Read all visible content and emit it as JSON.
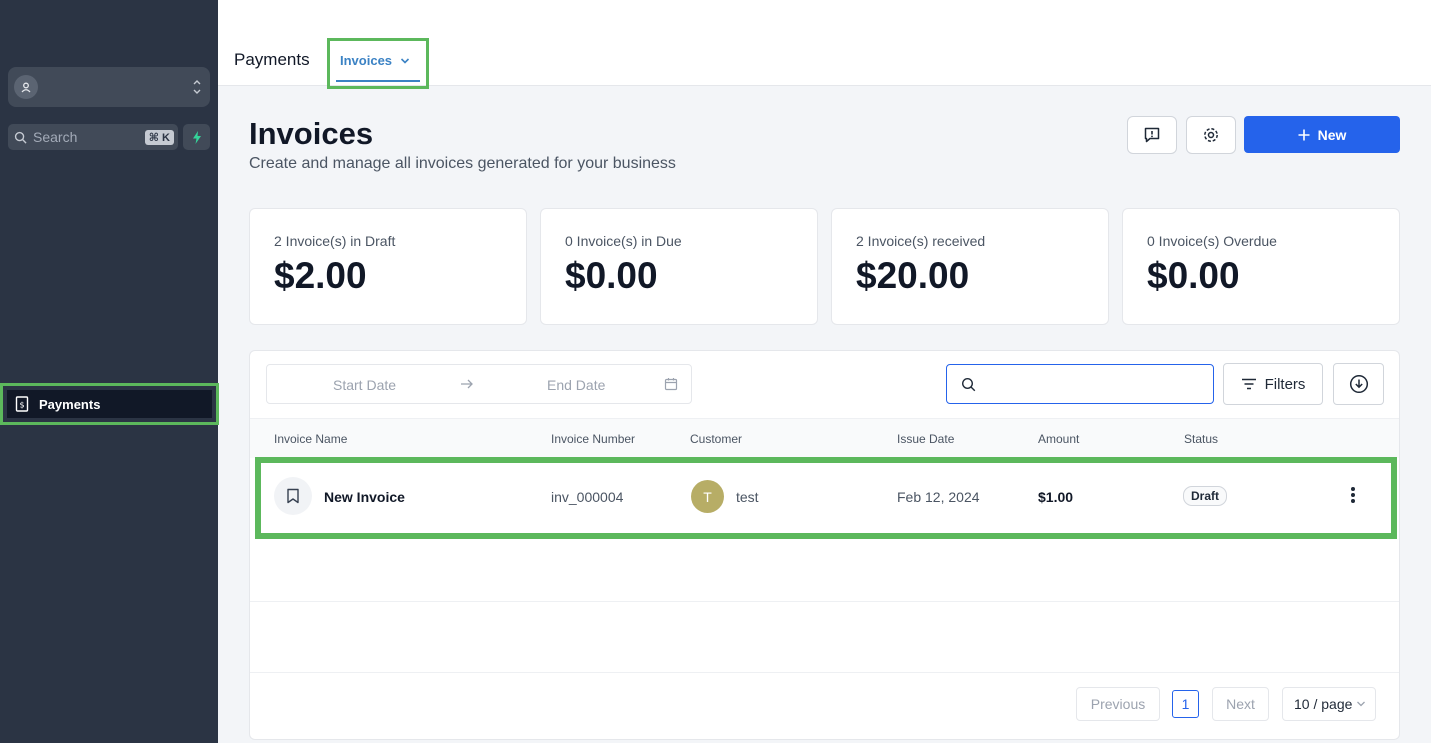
{
  "sidebar": {
    "search_placeholder": "Search",
    "search_shortcut": "⌘ K",
    "nav_items": [
      {
        "label": "Payments",
        "icon": "invoice-icon",
        "active": true
      }
    ]
  },
  "topbar": {
    "title": "Payments",
    "tabs": [
      {
        "label": "Invoices",
        "active": true
      }
    ]
  },
  "header": {
    "title": "Invoices",
    "subtitle": "Create and manage all invoices generated for your business",
    "new_button": "New"
  },
  "stats": [
    {
      "label": "2 Invoice(s) in Draft",
      "value": "$2.00"
    },
    {
      "label": "0 Invoice(s) in Due",
      "value": "$0.00"
    },
    {
      "label": "2 Invoice(s) received",
      "value": "$20.00"
    },
    {
      "label": "0 Invoice(s) Overdue",
      "value": "$0.00"
    }
  ],
  "toolbar": {
    "start_date_placeholder": "Start Date",
    "end_date_placeholder": "End Date",
    "search_value": "",
    "filters_label": "Filters"
  },
  "table": {
    "columns": [
      "Invoice Name",
      "Invoice Number",
      "Customer",
      "Issue Date",
      "Amount",
      "Status"
    ],
    "rows": [
      {
        "name": "New Invoice",
        "number": "inv_000004",
        "customer_initial": "T",
        "customer": "test",
        "issue_date": "Feb 12, 2024",
        "amount": "$1.00",
        "status": "Draft"
      }
    ]
  },
  "pagination": {
    "previous": "Previous",
    "current_page": "1",
    "next": "Next",
    "page_size": "10 / page"
  },
  "colors": {
    "sidebar_bg": "#2b3444",
    "primary": "#2563eb",
    "tab_accent": "#3b82c4",
    "highlight": "#5cb85c"
  }
}
